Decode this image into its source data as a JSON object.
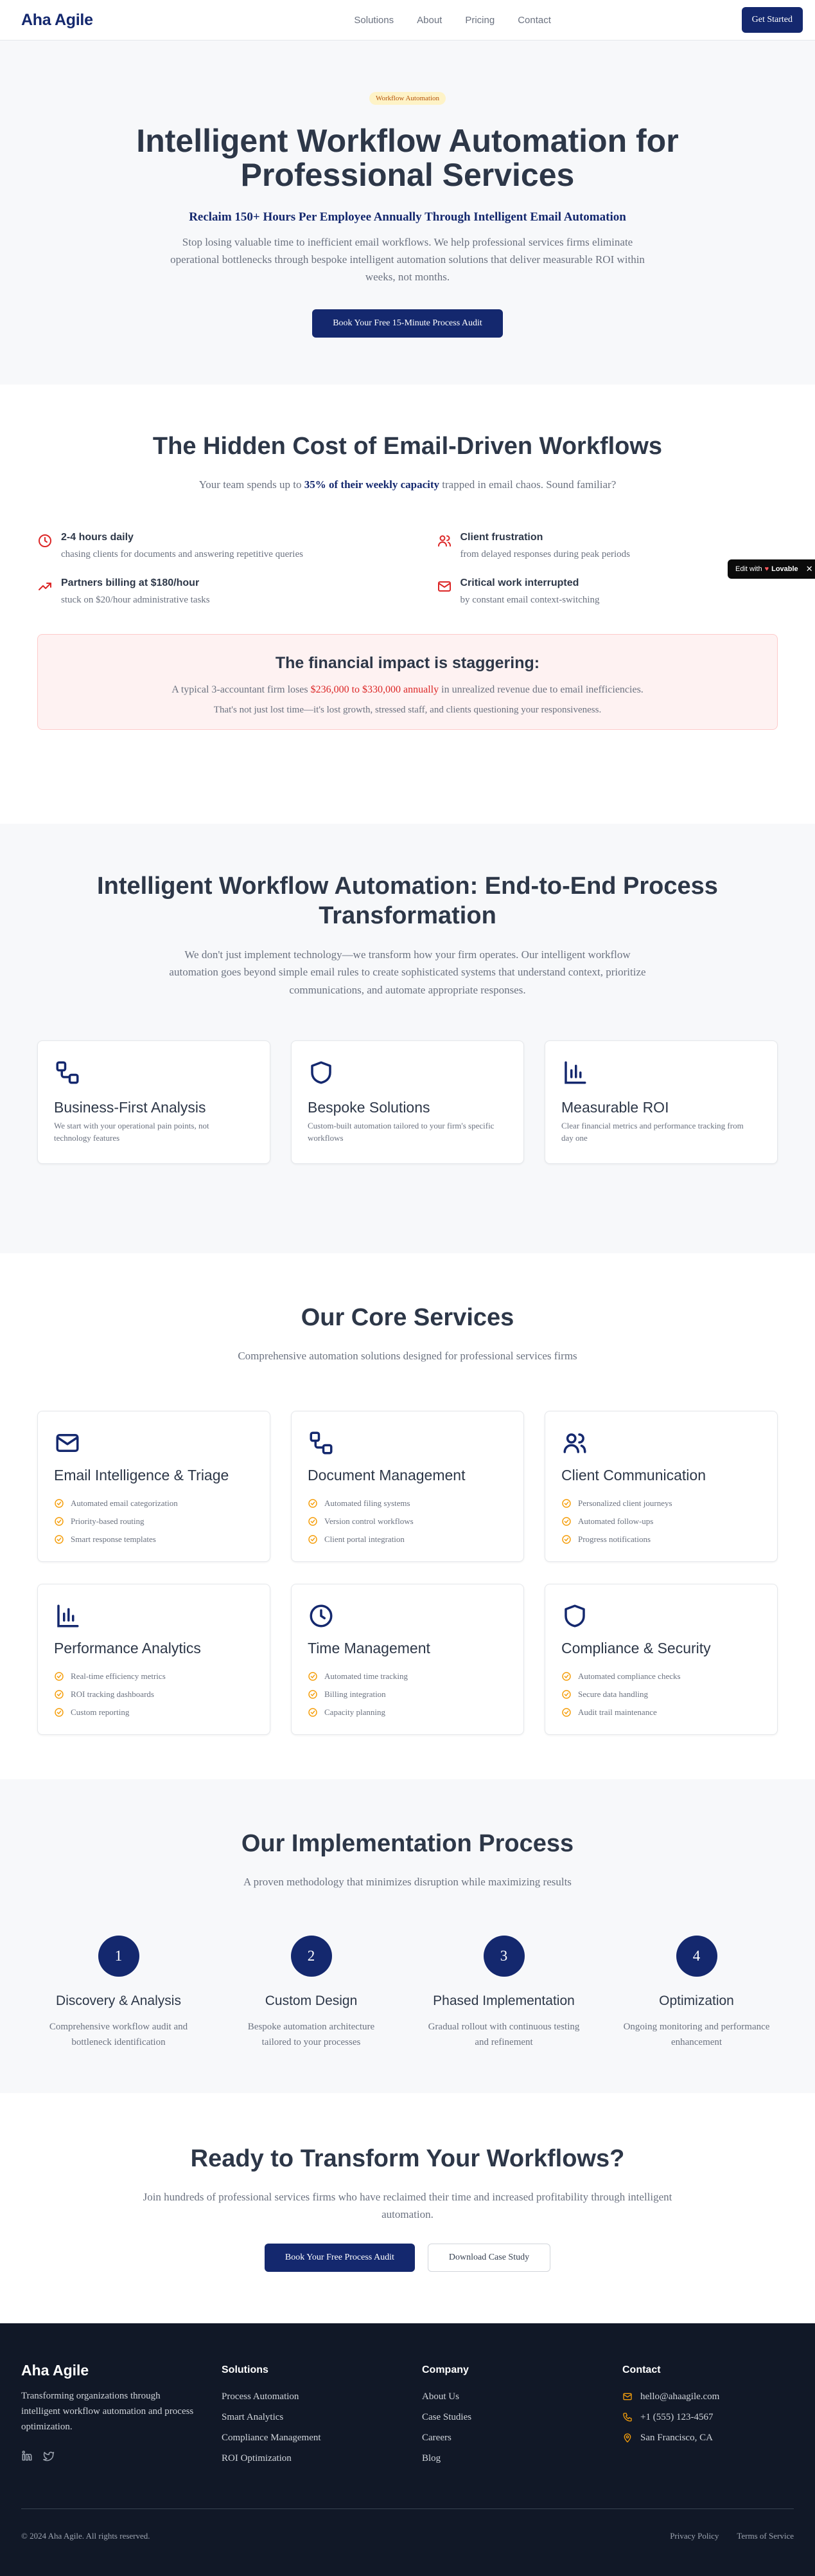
{
  "brand": {
    "name": "Aha Agile"
  },
  "nav": {
    "links": [
      "Solutions",
      "About",
      "Pricing",
      "Contact"
    ],
    "cta": "Get Started"
  },
  "hero": {
    "badge": "Workflow Automation",
    "title": "Intelligent Workflow Automation for Professional Services",
    "subtitle": "Reclaim 150+ Hours Per Employee Annually Through Intelligent Email Automation",
    "description": "Stop losing valuable time to inefficient email workflows. We help professional services firms eliminate operational bottlenecks through bespoke intelligent automation solutions that deliver measurable ROI within weeks, not months.",
    "cta": "Book Your Free 15-Minute Process Audit"
  },
  "cost": {
    "title": "The Hidden Cost of Email-Driven Workflows",
    "sub_prefix": "Your team spends up to",
    "sub_highlight": "35% of their weekly capacity",
    "sub_suffix": "trapped in email chaos. Sound familiar?",
    "pains": [
      {
        "icon": "clock-icon",
        "title": "2-4 hours daily",
        "desc": "chasing clients for documents and answering repetitive queries"
      },
      {
        "icon": "users-icon",
        "title": "Client frustration",
        "desc": "from delayed responses during peak periods"
      },
      {
        "icon": "trending-up-icon",
        "title": "Partners billing at $180/hour",
        "desc": "stuck on $20/hour administrative tasks"
      },
      {
        "icon": "mail-icon",
        "title": "Critical work interrupted",
        "desc": "by constant email context-switching"
      }
    ],
    "impact": {
      "title": "The financial impact is staggering:",
      "line_prefix": "A typical 3-accountant firm loses",
      "line_highlight": "$236,000 to $330,000 annually",
      "line_suffix": "in unrealized revenue due to email inefficiencies.",
      "note": "That's not just lost time—it's lost growth, stressed staff, and clients questioning your responsiveness."
    }
  },
  "solution": {
    "title": "Intelligent Workflow Automation: End-to-End Process Transformation",
    "description": "We don't just implement technology—we transform how your firm operates. Our intelligent workflow automation goes beyond simple email rules to create sophisticated systems that understand context, prioritize communications, and automate appropriate responses.",
    "features": [
      {
        "icon": "workflow-icon",
        "title": "Business-First Analysis",
        "desc": "We start with your operational pain points, not technology features"
      },
      {
        "icon": "shield-icon",
        "title": "Bespoke Solutions",
        "desc": "Custom-built automation tailored to your firm's specific workflows"
      },
      {
        "icon": "bar-chart-icon",
        "title": "Measurable ROI",
        "desc": "Clear financial metrics and performance tracking from day one"
      }
    ]
  },
  "services": {
    "title": "Our Core Services",
    "subtitle": "Comprehensive automation solutions designed for professional services firms",
    "items": [
      {
        "icon": "mail-icon",
        "title": "Email Intelligence & Triage",
        "bullets": [
          "Automated email categorization",
          "Priority-based routing",
          "Smart response templates"
        ]
      },
      {
        "icon": "workflow-icon",
        "title": "Document Management",
        "bullets": [
          "Automated filing systems",
          "Version control workflows",
          "Client portal integration"
        ]
      },
      {
        "icon": "users-icon",
        "title": "Client Communication",
        "bullets": [
          "Personalized client journeys",
          "Automated follow-ups",
          "Progress notifications"
        ]
      },
      {
        "icon": "bar-chart-icon",
        "title": "Performance Analytics",
        "bullets": [
          "Real-time efficiency metrics",
          "ROI tracking dashboards",
          "Custom reporting"
        ]
      },
      {
        "icon": "clock-icon",
        "title": "Time Management",
        "bullets": [
          "Automated time tracking",
          "Billing integration",
          "Capacity planning"
        ]
      },
      {
        "icon": "shield-icon",
        "title": "Compliance & Security",
        "bullets": [
          "Automated compliance checks",
          "Secure data handling",
          "Audit trail maintenance"
        ]
      }
    ]
  },
  "process": {
    "title": "Our Implementation Process",
    "subtitle": "A proven methodology that minimizes disruption while maximizing results",
    "steps": [
      {
        "num": "1",
        "title": "Discovery & Analysis",
        "desc": "Comprehensive workflow audit and bottleneck identification"
      },
      {
        "num": "2",
        "title": "Custom Design",
        "desc": "Bespoke automation architecture tailored to your processes"
      },
      {
        "num": "3",
        "title": "Phased Implementation",
        "desc": "Gradual rollout with continuous testing and refinement"
      },
      {
        "num": "4",
        "title": "Optimization",
        "desc": "Ongoing monitoring and performance enhancement"
      }
    ]
  },
  "cta": {
    "title": "Ready to Transform Your Workflows?",
    "subtitle": "Join hundreds of professional services firms who have reclaimed their time and increased profitability through intelligent automation.",
    "primary": "Book Your Free Process Audit",
    "secondary": "Download Case Study"
  },
  "footer": {
    "logo": "Aha Agile",
    "description": "Transforming organizations through intelligent workflow automation and process optimization.",
    "solutions": {
      "heading": "Solutions",
      "links": [
        "Process Automation",
        "Smart Analytics",
        "Compliance Management",
        "ROI Optimization"
      ]
    },
    "company": {
      "heading": "Company",
      "links": [
        "About Us",
        "Case Studies",
        "Careers",
        "Blog"
      ]
    },
    "contact": {
      "heading": "Contact",
      "email": "hello@ahaagile.com",
      "phone": "+1 (555) 123-4567",
      "location": "San Francisco, CA"
    },
    "copyright": "© 2024 Aha Agile. All rights reserved.",
    "legal": [
      "Privacy Policy",
      "Terms of Service"
    ]
  },
  "edit_tag": {
    "prefix": "Edit with",
    "brand": "Lovable"
  },
  "colors": {
    "brand": "#14286e",
    "accent_amber": "#f59e0b",
    "alert_red": "#dc2626",
    "footer_bg": "#111827"
  }
}
